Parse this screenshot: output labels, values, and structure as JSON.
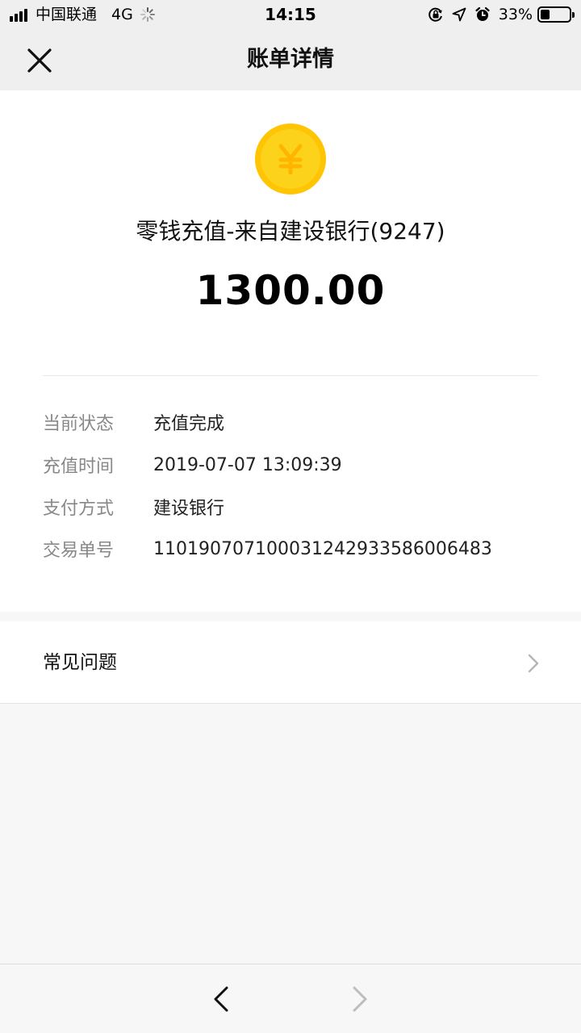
{
  "status_bar": {
    "carrier": "中国联通",
    "network": "4G",
    "time": "14:15",
    "battery_percent": "33%",
    "battery_level": 0.33
  },
  "nav": {
    "title": "账单详情",
    "close_icon": "close-icon"
  },
  "detail": {
    "icon": "yuan-coin-icon",
    "coin_symbol": "¥",
    "title": "零钱充值-来自建设银行(9247)",
    "amount": "1300.00",
    "rows": [
      {
        "label": "当前状态",
        "value": "充值完成"
      },
      {
        "label": "充值时间",
        "value": "2019-07-07 13:09:39"
      },
      {
        "label": "支付方式",
        "value": "建设银行"
      },
      {
        "label": "交易单号",
        "value": "110190707100031242933586006483"
      }
    ]
  },
  "faq": {
    "label": "常见问题",
    "icon": "chevron-right-icon"
  },
  "toolbar": {
    "back_icon": "back-arrow-icon",
    "forward_icon": "forward-arrow-icon"
  },
  "colors": {
    "coin_outer": "#ffc402",
    "coin_inner": "#fcd21b",
    "background": "#f7f7f7",
    "nav_background": "#efefef"
  }
}
